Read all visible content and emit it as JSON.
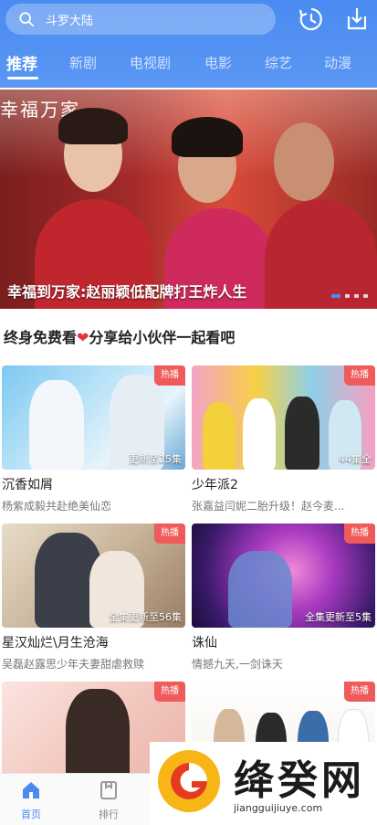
{
  "search": {
    "placeholder": "斗罗大陆"
  },
  "tabs": [
    {
      "label": "推荐",
      "active": true
    },
    {
      "label": "新剧"
    },
    {
      "label": "电视剧"
    },
    {
      "label": "电影"
    },
    {
      "label": "综艺"
    },
    {
      "label": "动漫"
    }
  ],
  "banner": {
    "logo_text": "幸福万家",
    "caption": "幸福到万家:赵丽颖低配牌打王炸人生",
    "slides_count": 4
  },
  "section": {
    "title_a": "终身免费看",
    "title_b": "分享给小伙伴一起看吧"
  },
  "cards": [
    {
      "title": "沉香如屑",
      "sub": "杨紫成毅共赴绝美仙恋",
      "ep": "更新至25集",
      "badge": "热播"
    },
    {
      "title": "少年派2",
      "sub": "张嘉益闫妮二胎升级！赵今麦...",
      "ep": "44集全",
      "badge": "热播"
    },
    {
      "title": "星汉灿烂\\月生沧海",
      "sub": "吴磊赵露思少年夫妻甜虐救赎",
      "ep": "全集更新至56集",
      "badge": "热播"
    },
    {
      "title": "诛仙",
      "sub": "情撼九天,一剑诛天",
      "ep": "全集更新至5集",
      "badge": "热播"
    },
    {
      "title": "",
      "sub": "",
      "ep": "",
      "badge": "热播"
    },
    {
      "title": "",
      "sub": "",
      "ep": "",
      "badge": "热播"
    }
  ],
  "bottom_nav": [
    {
      "label": "首页",
      "icon": "home-icon",
      "active": true
    },
    {
      "label": "排行",
      "icon": "ranking-icon"
    }
  ],
  "watermark": {
    "text": "绛癸网",
    "url": "jiangguijiuye.com"
  },
  "colors": {
    "accent": "#4a8bf2",
    "badge": "#ef5a5a",
    "heart": "#e8323c"
  }
}
